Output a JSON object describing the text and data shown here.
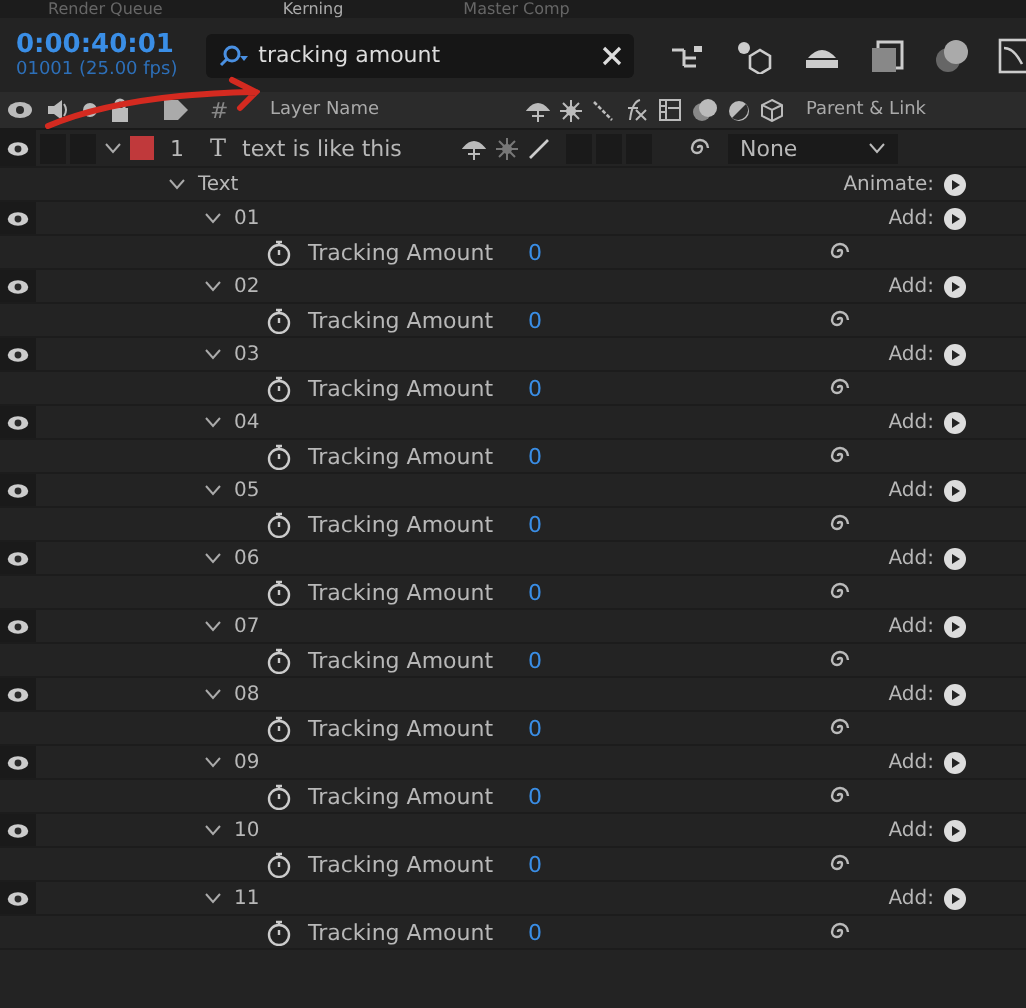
{
  "tabs": [
    {
      "label": "Render Queue",
      "selected": false
    },
    {
      "label": "Kerning",
      "selected": true
    },
    {
      "label": "Master Comp",
      "selected": false
    }
  ],
  "timecode": "0:00:40:01",
  "frame_info": "01001 (25.00 fps)",
  "search": {
    "value": "tracking amount"
  },
  "columns": {
    "number": "#",
    "layer_name": "Layer Name",
    "parent": "Parent & Link"
  },
  "layer": {
    "number": "1",
    "type_glyph": "T",
    "name": "text is like this",
    "color": "#c0393b",
    "parent": "None",
    "visible": true,
    "audio_on": false,
    "locked": false
  },
  "text_group": {
    "label": "Text",
    "animate_label": "Animate:"
  },
  "animators": [
    {
      "name": "01",
      "add_label": "Add:",
      "visible": true,
      "property": "Tracking Amount",
      "value": "0"
    },
    {
      "name": "02",
      "add_label": "Add:",
      "visible": true,
      "property": "Tracking Amount",
      "value": "0"
    },
    {
      "name": "03",
      "add_label": "Add:",
      "visible": true,
      "property": "Tracking Amount",
      "value": "0"
    },
    {
      "name": "04",
      "add_label": "Add:",
      "visible": true,
      "property": "Tracking Amount",
      "value": "0"
    },
    {
      "name": "05",
      "add_label": "Add:",
      "visible": true,
      "property": "Tracking Amount",
      "value": "0"
    },
    {
      "name": "06",
      "add_label": "Add:",
      "visible": true,
      "property": "Tracking Amount",
      "value": "0"
    },
    {
      "name": "07",
      "add_label": "Add:",
      "visible": true,
      "property": "Tracking Amount",
      "value": "0"
    },
    {
      "name": "08",
      "add_label": "Add:",
      "visible": true,
      "property": "Tracking Amount",
      "value": "0"
    },
    {
      "name": "09",
      "add_label": "Add:",
      "visible": true,
      "property": "Tracking Amount",
      "value": "0"
    },
    {
      "name": "10",
      "add_label": "Add:",
      "visible": true,
      "property": "Tracking Amount",
      "value": "0"
    },
    {
      "name": "11",
      "add_label": "Add:",
      "visible": true,
      "property": "Tracking Amount",
      "value": "0"
    }
  ]
}
